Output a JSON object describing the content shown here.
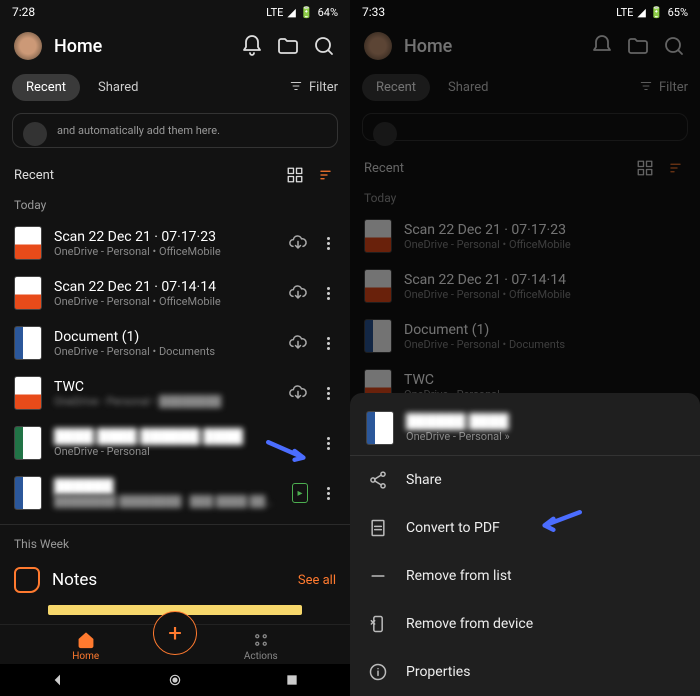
{
  "left": {
    "status": {
      "time": "7:28",
      "net": "LTE",
      "batt_pct": "64%"
    },
    "title": "Home",
    "tabs": {
      "recent": "Recent",
      "shared": "Shared",
      "filter": "Filter"
    },
    "banner": "and automatically add them here.",
    "section": "Recent",
    "label_today": "Today",
    "files": [
      {
        "name": "Scan 22 Dec 21 · 07·17·23",
        "meta": "OneDrive - Personal • OfficeMobile",
        "icon": "pdf",
        "dl": true
      },
      {
        "name": "Scan 22 Dec 21 · 07·14·14",
        "meta": "OneDrive - Personal • OfficeMobile",
        "icon": "pdf",
        "dl": true
      },
      {
        "name": "Document (1)",
        "meta": "OneDrive - Personal • Documents",
        "icon": "docx",
        "dl": true
      },
      {
        "name": "TWC",
        "meta": "OneDrive - Personal • ████████",
        "icon": "pdf",
        "dl": true,
        "meta_blur": true
      },
      {
        "name": "████ ████ ██████ ████",
        "meta": "OneDrive - Personal",
        "icon": "xlsx",
        "dl": false,
        "name_blur": true
      },
      {
        "name": "██████",
        "meta": "████████ ████████ · ███ ████ ████",
        "icon": "docx",
        "dl": false,
        "name_blur": true,
        "meta_blur": true,
        "badge": true
      }
    ],
    "label_week": "This Week",
    "notes": {
      "title": "Notes",
      "seeall": "See all"
    },
    "nav": {
      "home": "Home",
      "actions": "Actions"
    }
  },
  "right": {
    "status": {
      "time": "7:33",
      "net": "LTE",
      "batt_pct": "65%"
    },
    "title": "Home",
    "tabs": {
      "recent": "Recent",
      "shared": "Shared",
      "filter": "Filter"
    },
    "section": "Recent",
    "label_today": "Today",
    "files": [
      {
        "name": "Scan 22 Dec 21 · 07·17·23",
        "meta": "OneDrive - Personal • OfficeMobile",
        "icon": "pdf"
      },
      {
        "name": "Scan 22 Dec 21 · 07·14·14",
        "meta": "OneDrive - Personal • OfficeMobile",
        "icon": "pdf"
      },
      {
        "name": "Document (1)",
        "meta": "OneDrive - Personal • Documents",
        "icon": "docx"
      },
      {
        "name": "TWC",
        "meta": "OneDrive - Personal",
        "icon": "pdf"
      }
    ],
    "sheet": {
      "file": {
        "name": "██████ ████",
        "meta": "OneDrive - Personal » ",
        "name_blur": true
      },
      "items": [
        {
          "icon": "share",
          "label": "Share"
        },
        {
          "icon": "pdf",
          "label": "Convert to PDF",
          "arrow": true
        },
        {
          "icon": "minus",
          "label": "Remove from list"
        },
        {
          "icon": "phone-x",
          "label": "Remove from device"
        },
        {
          "icon": "info",
          "label": "Properties"
        }
      ]
    }
  }
}
